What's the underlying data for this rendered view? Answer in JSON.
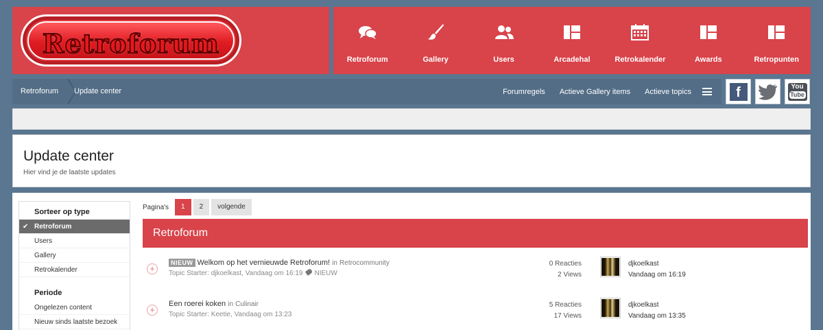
{
  "logo": {
    "text": "Retroforum"
  },
  "nav": [
    {
      "label": "Retroforum",
      "icon": "chat-bubbles-icon"
    },
    {
      "label": "Gallery",
      "icon": "paintbrush-icon"
    },
    {
      "label": "Users",
      "icon": "users-icon"
    },
    {
      "label": "Arcadehal",
      "icon": "layout-icon"
    },
    {
      "label": "Retrokalender",
      "icon": "calendar-icon"
    },
    {
      "label": "Awards",
      "icon": "layout-icon"
    },
    {
      "label": "Retropunten",
      "icon": "layout-icon"
    }
  ],
  "breadcrumb": {
    "home": "Retroforum",
    "current": "Update center"
  },
  "toplinks": [
    "Forumregels",
    "Actieve Gallery items",
    "Actieve topics"
  ],
  "social": {
    "facebook": "f",
    "youtube_top": "You",
    "youtube_bottom": "Tube"
  },
  "page": {
    "title": "Update center",
    "subtitle": "Hier vind je de laatste updates"
  },
  "sidebar": {
    "type_heading": "Sorteer op type",
    "type_items": [
      "Retroforum",
      "Users",
      "Gallery",
      "Retrokalender"
    ],
    "period_heading": "Periode",
    "period_items": [
      "Ongelezen content",
      "Nieuw sinds laatste bezoek"
    ]
  },
  "pager": {
    "label": "Pagina's",
    "pages": [
      "1",
      "2"
    ],
    "next": "volgende"
  },
  "section": {
    "title": "Retroforum"
  },
  "topics": [
    {
      "badge": "NIEUW",
      "title": "Welkom op het vernieuwde Retroforum!",
      "in_label": "in",
      "forum": "Retrocommunity",
      "meta": "Topic Starter: djkoelkast, Vandaag om 16:19",
      "tag": "NIEUW",
      "replies": "0 Reacties",
      "views": "2 Views",
      "user": "djkoelkast",
      "time": "Vandaag om 16:19"
    },
    {
      "badge": "",
      "title": "Een roerei koken",
      "in_label": "in",
      "forum": "Culinair",
      "meta": "Topic Starter: Keetie, Vandaag om 13:23",
      "tag": "",
      "replies": "5 Reacties",
      "views": "17 Views",
      "user": "djkoelkast",
      "time": "Vandaag om 13:35"
    }
  ],
  "colors": {
    "accent": "#d9434a",
    "bar": "#536d86",
    "background": "#5a7690"
  }
}
